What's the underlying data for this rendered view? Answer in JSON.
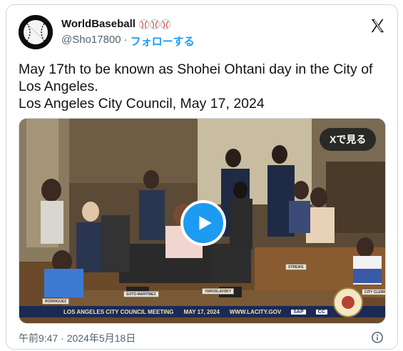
{
  "author": {
    "name": "WorldBaseball",
    "name_emoji": [
      "baseball-icon",
      "baseball-icon",
      "baseball-icon"
    ],
    "handle": "@Sho17800",
    "separator": "·",
    "follow_label": "フォローする",
    "avatar_icon": "baseball-avatar-icon"
  },
  "platform_icon": "x-logo-icon",
  "post": {
    "lines": [
      "May 17th to be known as Shohei Ohtani day in the City of",
      "Los Angeles.",
      "Los Angeles City Council, May 17, 2024"
    ]
  },
  "media": {
    "see_on_x_label": "Xで見る",
    "play_icon": "play-icon",
    "ticker": {
      "meeting": "LOS ANGELES CITY COUNCIL MEETING",
      "date": "MAY 17, 2024",
      "url": "WWW.LACITY.GOV",
      "sap": "SAP",
      "cc": "CC"
    },
    "nameplates": [
      "RODRIGUEZ",
      "SOTO-MARTINEZ",
      "YAROSLAVSKY",
      "STREIKE",
      "CITY CLERK"
    ]
  },
  "footer": {
    "timestamp": "午前9:47 · 2024年5月18日",
    "info_icon": "info-icon"
  },
  "colors": {
    "accent": "#1d9bf0",
    "text": "#0f1419",
    "muted": "#536471",
    "border": "#cfd9de",
    "ticker_bg": "#1a2a55"
  }
}
